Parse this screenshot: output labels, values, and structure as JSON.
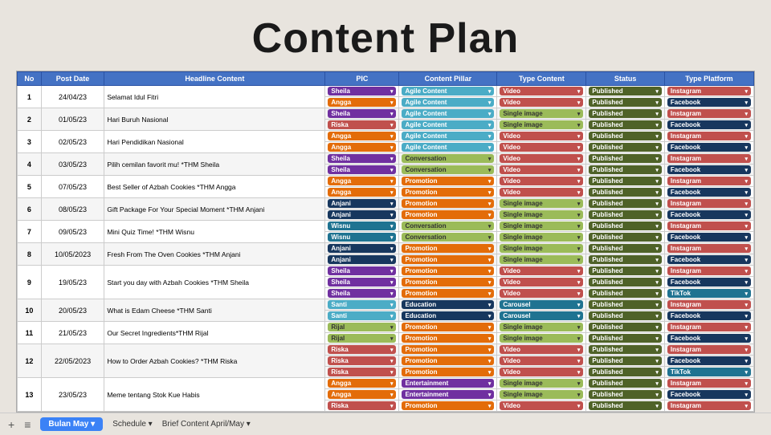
{
  "title": "Content Plan",
  "table": {
    "headers": [
      "No",
      "Post Date",
      "Headline Content",
      "PIC",
      "Content Pillar",
      "Type Content",
      "Status",
      "Type Platform"
    ],
    "rows": [
      {
        "no": "1",
        "date": "24/04/23",
        "headline": "Selamat Idul Fitri",
        "subrows": [
          {
            "pic": "Sheila",
            "pic_cls": "badge-sheila",
            "pillar": "Agile Content",
            "pillar_cls": "badge-agile",
            "type": "Video",
            "type_cls": "badge-video",
            "status": "Published",
            "platform": "Instagram",
            "platform_cls": "badge-instagram"
          },
          {
            "pic": "Angga",
            "pic_cls": "badge-angga",
            "pillar": "Agile Content",
            "pillar_cls": "badge-agile",
            "type": "Video",
            "type_cls": "badge-video",
            "status": "Published",
            "platform": "Facebook",
            "platform_cls": "badge-facebook"
          }
        ]
      },
      {
        "no": "2",
        "date": "01/05/23",
        "headline": "Hari Buruh Nasional",
        "subrows": [
          {
            "pic": "Sheila",
            "pic_cls": "badge-sheila",
            "pillar": "Agile Content",
            "pillar_cls": "badge-agile",
            "type": "Single image",
            "type_cls": "badge-singleimage",
            "status": "Published",
            "platform": "Instagram",
            "platform_cls": "badge-instagram"
          },
          {
            "pic": "Riska",
            "pic_cls": "badge-riska",
            "pillar": "Agile Content",
            "pillar_cls": "badge-agile",
            "type": "Single image",
            "type_cls": "badge-singleimage",
            "status": "Published",
            "platform": "Facebook",
            "platform_cls": "badge-facebook"
          }
        ]
      },
      {
        "no": "3",
        "date": "02/05/23",
        "headline": "Hari Pendidikan Nasional",
        "subrows": [
          {
            "pic": "Angga",
            "pic_cls": "badge-angga",
            "pillar": "Agile Content",
            "pillar_cls": "badge-agile",
            "type": "Video",
            "type_cls": "badge-video",
            "status": "Published",
            "platform": "Instagram",
            "platform_cls": "badge-instagram"
          },
          {
            "pic": "Angga",
            "pic_cls": "badge-angga",
            "pillar": "Agile Content",
            "pillar_cls": "badge-agile",
            "type": "Video",
            "type_cls": "badge-video",
            "status": "Published",
            "platform": "Facebook",
            "platform_cls": "badge-facebook"
          }
        ]
      },
      {
        "no": "4",
        "date": "03/05/23",
        "headline": "Pilih cemilan favorit mu! *THM Sheila",
        "subrows": [
          {
            "pic": "Sheila",
            "pic_cls": "badge-sheila",
            "pillar": "Conversation",
            "pillar_cls": "badge-conversation",
            "type": "Video",
            "type_cls": "badge-video",
            "status": "Published",
            "platform": "Instagram",
            "platform_cls": "badge-instagram"
          },
          {
            "pic": "Sheila",
            "pic_cls": "badge-sheila",
            "pillar": "Conversation",
            "pillar_cls": "badge-conversation",
            "type": "Video",
            "type_cls": "badge-video",
            "status": "Published",
            "platform": "Facebook",
            "platform_cls": "badge-facebook"
          }
        ]
      },
      {
        "no": "5",
        "date": "07/05/23",
        "headline": "Best Seller of Azbah Cookies *THM Angga",
        "subrows": [
          {
            "pic": "Angga",
            "pic_cls": "badge-angga",
            "pillar": "Promotion",
            "pillar_cls": "badge-promotion",
            "type": "Video",
            "type_cls": "badge-video",
            "status": "Published",
            "platform": "Instagram",
            "platform_cls": "badge-instagram"
          },
          {
            "pic": "Angga",
            "pic_cls": "badge-angga",
            "pillar": "Promotion",
            "pillar_cls": "badge-promotion",
            "type": "Video",
            "type_cls": "badge-video",
            "status": "Published",
            "platform": "Facebook",
            "platform_cls": "badge-facebook"
          }
        ]
      },
      {
        "no": "6",
        "date": "08/05/23",
        "headline": "Gift Package For Your Special Moment *THM Anjani",
        "subrows": [
          {
            "pic": "Anjani",
            "pic_cls": "badge-anjani",
            "pillar": "Promotion",
            "pillar_cls": "badge-promotion",
            "type": "Single image",
            "type_cls": "badge-singleimage",
            "status": "Published",
            "platform": "Instagram",
            "platform_cls": "badge-instagram"
          },
          {
            "pic": "Anjani",
            "pic_cls": "badge-anjani",
            "pillar": "Promotion",
            "pillar_cls": "badge-promotion",
            "type": "Single image",
            "type_cls": "badge-singleimage",
            "status": "Published",
            "platform": "Facebook",
            "platform_cls": "badge-facebook"
          }
        ]
      },
      {
        "no": "7",
        "date": "09/05/23",
        "headline": "Mini Quiz Time! *THM Wisnu",
        "subrows": [
          {
            "pic": "Wisnu",
            "pic_cls": "badge-wisnu",
            "pillar": "Conversation",
            "pillar_cls": "badge-conversation",
            "type": "Single image",
            "type_cls": "badge-singleimage",
            "status": "Published",
            "platform": "Instagram",
            "platform_cls": "badge-instagram"
          },
          {
            "pic": "Wisnu",
            "pic_cls": "badge-wisnu",
            "pillar": "Conversation",
            "pillar_cls": "badge-conversation",
            "type": "Single image",
            "type_cls": "badge-singleimage",
            "status": "Published",
            "platform": "Facebook",
            "platform_cls": "badge-facebook"
          }
        ]
      },
      {
        "no": "8",
        "date": "10/05/2023",
        "headline": "Fresh From The Oven Cookies *THM Anjani",
        "subrows": [
          {
            "pic": "Anjani",
            "pic_cls": "badge-anjani",
            "pillar": "Promotion",
            "pillar_cls": "badge-promotion",
            "type": "Single image",
            "type_cls": "badge-singleimage",
            "status": "Published",
            "platform": "Instagram",
            "platform_cls": "badge-instagram"
          },
          {
            "pic": "Anjani",
            "pic_cls": "badge-anjani",
            "pillar": "Promotion",
            "pillar_cls": "badge-promotion",
            "type": "Single image",
            "type_cls": "badge-singleimage",
            "status": "Published",
            "platform": "Facebook",
            "platform_cls": "badge-facebook"
          }
        ]
      },
      {
        "no": "9",
        "date": "19/05/23",
        "headline": "Start you day with Azbah Cookies *THM Sheila",
        "subrows": [
          {
            "pic": "Sheila",
            "pic_cls": "badge-sheila",
            "pillar": "Promotion",
            "pillar_cls": "badge-promotion",
            "type": "Video",
            "type_cls": "badge-video",
            "status": "Published",
            "platform": "Instagram",
            "platform_cls": "badge-instagram"
          },
          {
            "pic": "Sheila",
            "pic_cls": "badge-sheila",
            "pillar": "Promotion",
            "pillar_cls": "badge-promotion",
            "type": "Video",
            "type_cls": "badge-video",
            "status": "Published",
            "platform": "Facebook",
            "platform_cls": "badge-facebook"
          },
          {
            "pic": "Sheila",
            "pic_cls": "badge-sheila",
            "pillar": "Promotion",
            "pillar_cls": "badge-promotion",
            "type": "Video",
            "type_cls": "badge-video",
            "status": "Published",
            "platform": "TikTok",
            "platform_cls": "badge-tiktok"
          }
        ]
      },
      {
        "no": "10",
        "date": "20/05/23",
        "headline": "What is Edam Cheese *THM Santi",
        "subrows": [
          {
            "pic": "Santi",
            "pic_cls": "badge-santi",
            "pillar": "Education",
            "pillar_cls": "badge-education",
            "type": "Carousel",
            "type_cls": "badge-carousel",
            "status": "Published",
            "platform": "Instagram",
            "platform_cls": "badge-instagram"
          },
          {
            "pic": "Santi",
            "pic_cls": "badge-santi",
            "pillar": "Education",
            "pillar_cls": "badge-education",
            "type": "Carousel",
            "type_cls": "badge-carousel",
            "status": "Published",
            "platform": "Facebook",
            "platform_cls": "badge-facebook"
          }
        ]
      },
      {
        "no": "11",
        "date": "21/05/23",
        "headline": "Our Secret Ingredients*THM Rijal",
        "subrows": [
          {
            "pic": "Rijal",
            "pic_cls": "badge-rijal",
            "pillar": "Promotion",
            "pillar_cls": "badge-promotion",
            "type": "Single image",
            "type_cls": "badge-singleimage",
            "status": "Published",
            "platform": "Instagram",
            "platform_cls": "badge-instagram"
          },
          {
            "pic": "Rijal",
            "pic_cls": "badge-rijal",
            "pillar": "Promotion",
            "pillar_cls": "badge-promotion",
            "type": "Single image",
            "type_cls": "badge-singleimage",
            "status": "Published",
            "platform": "Facebook",
            "platform_cls": "badge-facebook"
          }
        ]
      },
      {
        "no": "12",
        "date": "22/05/2023",
        "headline": "How to Order Azbah Cookies? *THM Riska",
        "subrows": [
          {
            "pic": "Riska",
            "pic_cls": "badge-riska",
            "pillar": "Promotion",
            "pillar_cls": "badge-promotion",
            "type": "Video",
            "type_cls": "badge-video",
            "status": "Published",
            "platform": "Instagram",
            "platform_cls": "badge-instagram"
          },
          {
            "pic": "Riska",
            "pic_cls": "badge-riska",
            "pillar": "Promotion",
            "pillar_cls": "badge-promotion",
            "type": "Video",
            "type_cls": "badge-video",
            "status": "Published",
            "platform": "Facebook",
            "platform_cls": "badge-facebook"
          },
          {
            "pic": "Riska",
            "pic_cls": "badge-riska",
            "pillar": "Promotion",
            "pillar_cls": "badge-promotion",
            "type": "Video",
            "type_cls": "badge-video",
            "status": "Published",
            "platform": "TikTok",
            "platform_cls": "badge-tiktok"
          }
        ]
      },
      {
        "no": "13",
        "date": "23/05/23",
        "headline": "Meme tentang Stok Kue Habis",
        "subrows": [
          {
            "pic": "Angga",
            "pic_cls": "badge-angga",
            "pillar": "Entertainment",
            "pillar_cls": "badge-entertainment",
            "type": "Single image",
            "type_cls": "badge-singleimage",
            "status": "Published",
            "platform": "Instagram",
            "platform_cls": "badge-instagram"
          },
          {
            "pic": "Angga",
            "pic_cls": "badge-angga",
            "pillar": "Entertainment",
            "pillar_cls": "badge-entertainment",
            "type": "Single image",
            "type_cls": "badge-singleimage",
            "status": "Published",
            "platform": "Facebook",
            "platform_cls": "badge-facebook"
          },
          {
            "pic": "Riska",
            "pic_cls": "badge-riska",
            "pillar": "Promotion",
            "pillar_cls": "badge-promotion",
            "type": "Video",
            "type_cls": "badge-video",
            "status": "Published",
            "platform": "Instagram",
            "platform_cls": "badge-instagram"
          }
        ]
      }
    ]
  },
  "bottombar": {
    "plus": "+",
    "menu": "≡",
    "tab_active": "Bulan May",
    "tab_arrow": "▾",
    "schedule": "Schedule",
    "brief": "Brief Content April/May"
  }
}
